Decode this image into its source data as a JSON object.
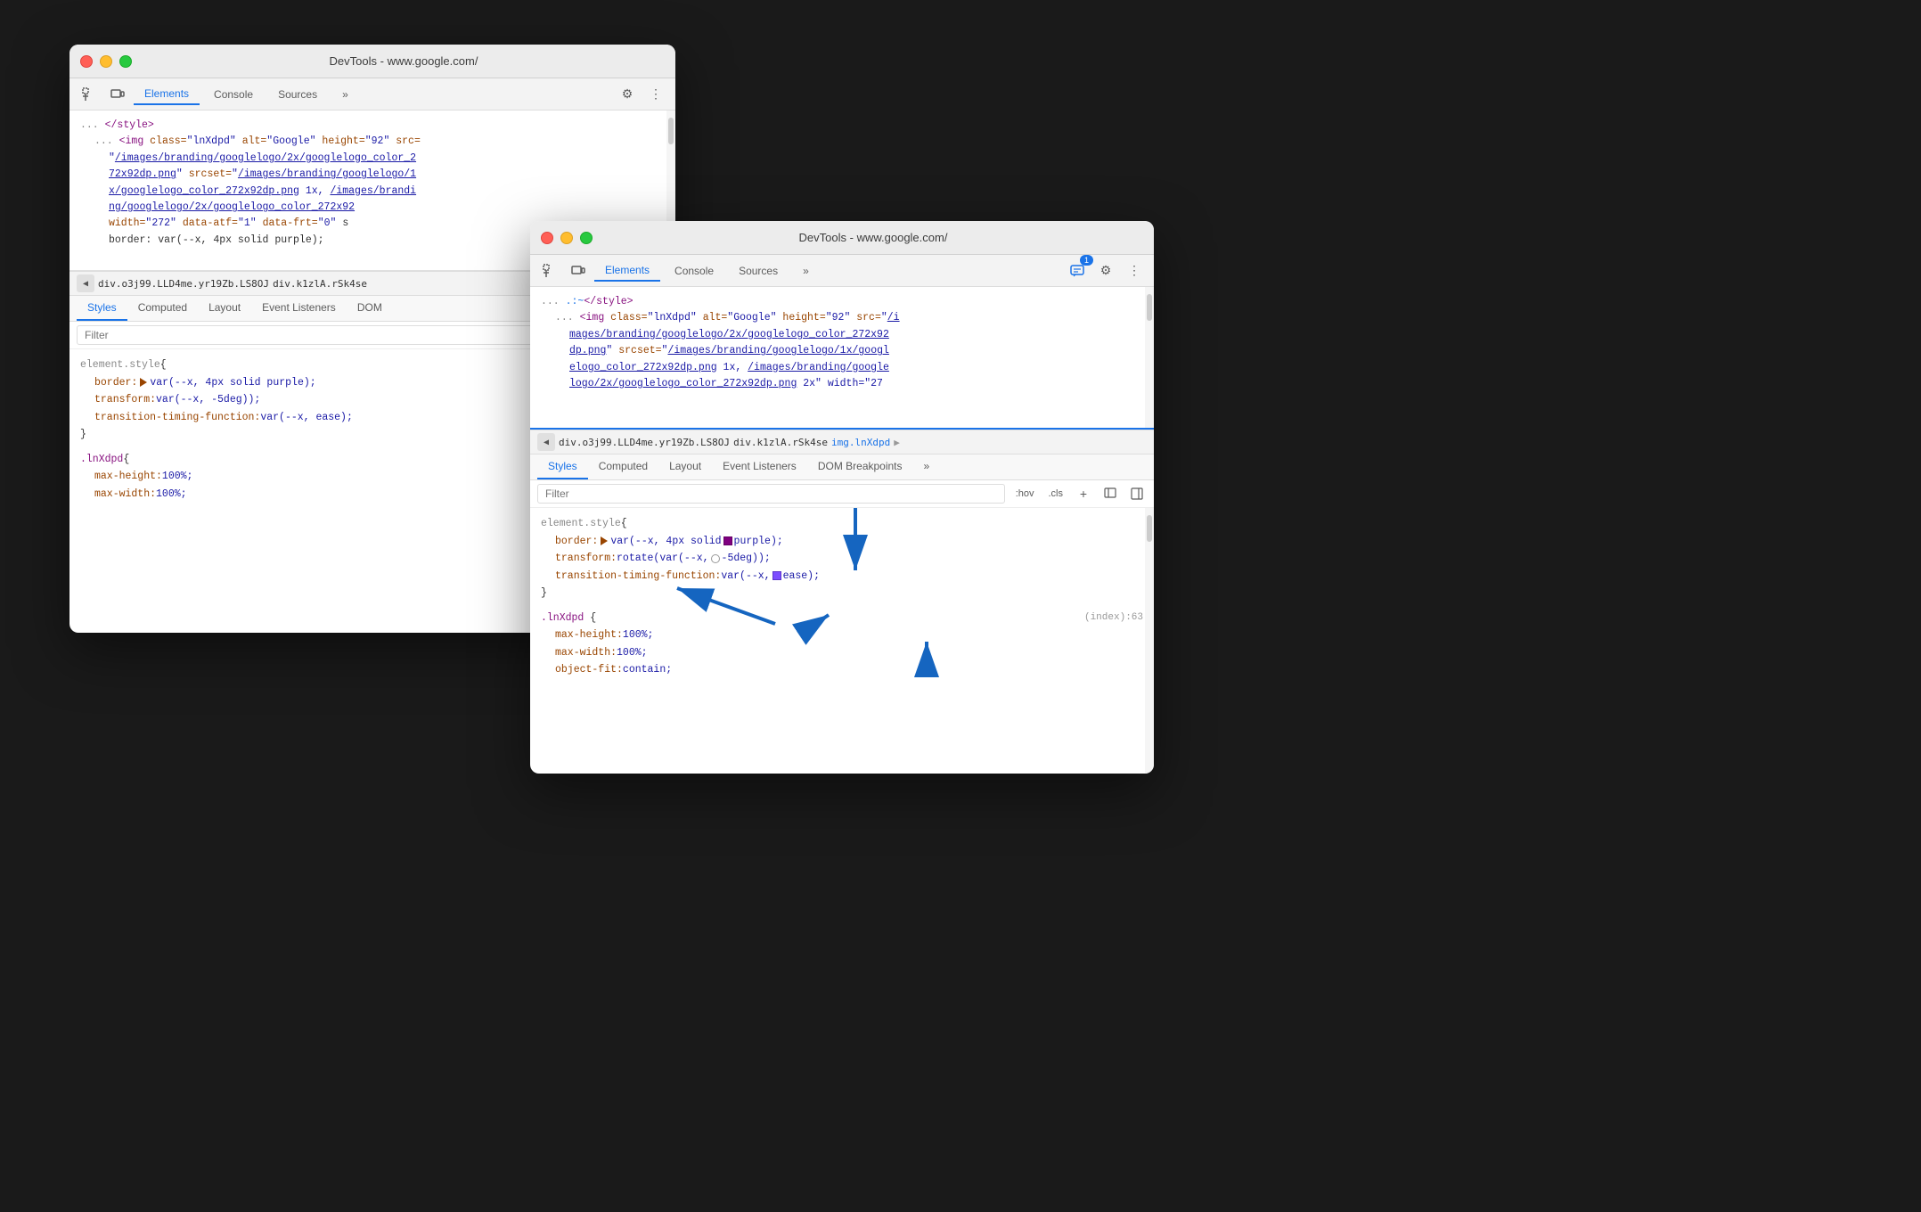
{
  "window1": {
    "title": "DevTools - www.google.com/",
    "toolbar": {
      "tabs": [
        "Elements",
        "Console",
        "Sources",
        ">>"
      ],
      "active_tab": "Elements"
    },
    "html_content": [
      ".:~</style>",
      "<img class=\"lnXdpd\" alt=\"Google\" height=\"92\" src=",
      "\"/images/branding/googlelogo/2x/googlelogo_color_2",
      "72x92dp.png\" srcset=\"/images/branding/googlelogo/1",
      "x/googlelogo_color_272x92dp.png 1x, /images/brandi",
      "ng/googlelogo/2x/googlelogo_color_272x92",
      "width=\"272\" data-atf=\"1\" data-frt=\"0\" s",
      "border: var(--x, 4px solid purple);"
    ],
    "breadcrumb": [
      "div.o3j99.LLD4me.yr19Zb.LS8OJ",
      "div.k1zlA.rSk4se"
    ],
    "panel_tabs": [
      "Styles",
      "Computed",
      "Layout",
      "Event Listeners",
      "DOM"
    ],
    "active_panel_tab": "Styles",
    "filter_placeholder": "Filter",
    "css_rules": {
      "element_style": {
        "selector": "element.style {",
        "properties": [
          {
            "prop": "border:",
            "value": "▶ var(--x, 4px solid purple);"
          },
          {
            "prop": "transform:",
            "value": "var(--x, -5deg));"
          },
          {
            "prop": "transition-timing-function:",
            "value": "var(--x, ease);"
          }
        ]
      },
      "lnXdpd": {
        "selector": ".lnXdpd {",
        "properties": [
          {
            "prop": "max-height:",
            "value": "100%;"
          },
          {
            "prop": "max-width:",
            "value": "100%;"
          }
        ]
      }
    }
  },
  "window2": {
    "title": "DevTools - www.google.com/",
    "toolbar": {
      "tabs": [
        "Elements",
        "Console",
        "Sources",
        ">>"
      ],
      "active_tab": "Elements",
      "badge": "1"
    },
    "html_content": [
      ".:~</style>",
      "<img class=\"lnXdpd\" alt=\"Google\" height=\"92\" src=\"/i",
      "mages/branding/googlelogo/2x/googlelogo_color_272x92",
      "dp.png\" srcset=\"/images/branding/googlelogo/1x/googl",
      "elogo_color_272x92dp.png 1x, /images/branding/google",
      "logo/2x/googlelogo_color_272x92dp.png 2x\" width=\"27"
    ],
    "breadcrumb": [
      "div.o3j99.LLD4me.yr19Zb.LS8OJ",
      "div.k1zlA.rSk4se",
      "img.lnXdpd"
    ],
    "panel_tabs": [
      "Styles",
      "Computed",
      "Layout",
      "Event Listeners",
      "DOM Breakpoints",
      ">>"
    ],
    "active_panel_tab": "Styles",
    "filter_placeholder": "Filter",
    "css_rules": {
      "element_style": {
        "selector": "element.style {",
        "properties": [
          {
            "prop": "border:",
            "value": "▶ var(--x, 4px solid",
            "swatch": "purple",
            "value2": "purple);"
          },
          {
            "prop": "transform:",
            "value": "rotate(var(--x,",
            "circle": true,
            "value2": "-5deg));"
          },
          {
            "prop": "transition-timing-function:",
            "value": "var(--x,",
            "checkbox": true,
            "value2": "ease);"
          }
        ]
      },
      "lnXdpd": {
        "selector": ".lnXdpd {",
        "properties": [
          {
            "prop": "max-height:",
            "value": "100%;"
          },
          {
            "prop": "max-width:",
            "value": "100%;"
          },
          {
            "prop": "object-fit:",
            "value": "contain;"
          }
        ],
        "source": "(index):63"
      }
    }
  },
  "labels": {
    "hov": ":hov",
    "cls": ".cls",
    "plus_icon": "+",
    "element_style_paren_open": "{",
    "element_style_paren_close": "}",
    "computed_tab": "Computed"
  },
  "icons": {
    "inspect": "⬚",
    "device": "⊡",
    "gear": "⚙",
    "more": "⋮",
    "more_tabs": "»",
    "chat": "💬",
    "back_arrow": "◀"
  }
}
